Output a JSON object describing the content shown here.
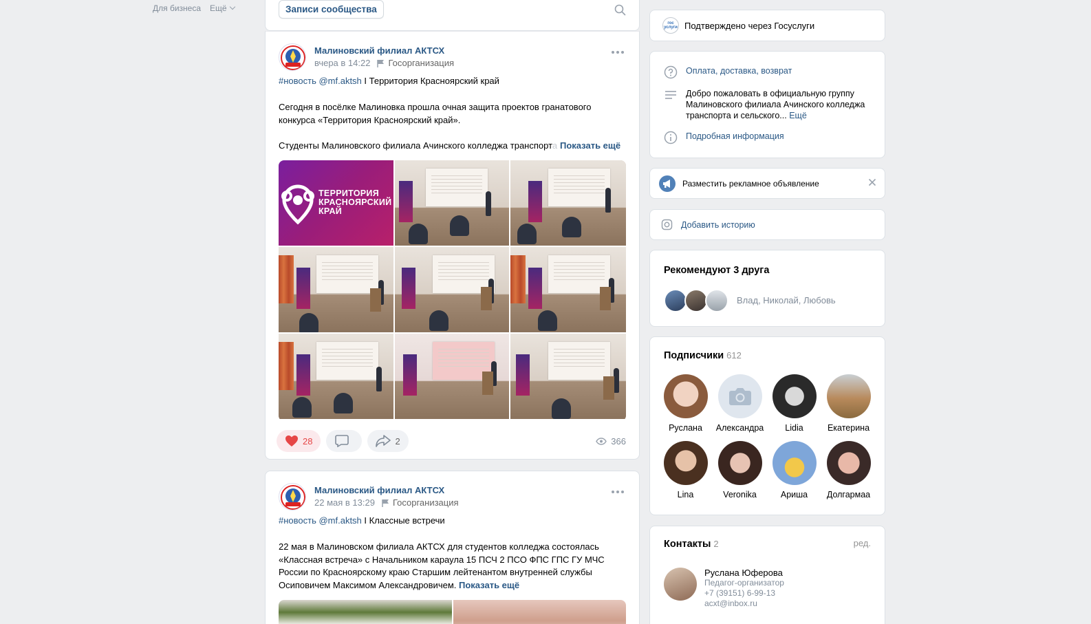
{
  "left_nav": {
    "business": "Для бизнеса",
    "more": "Ещё"
  },
  "tabs": {
    "active": "Записи сообщества",
    "search_icon": "search-icon"
  },
  "colors": {
    "link": "#2a5885",
    "like_red": "#e64646",
    "brand_purple": "#7a1f9e"
  },
  "post1": {
    "author": "Малиновский филиал АКТСХ",
    "time": "вчера в 14:22",
    "org": "Госорганизация",
    "tags": "#новость @mf.aktsh",
    "title": " I Территория Красноярский край",
    "p1": "Сегодня в посёлке Малиновка прошла очная защита проектов гранатового конкурса «Территория Красноярский край».",
    "p2": "Студенты Малиновского филиала Ачинского колледжа транспорт",
    "p2_fade": "а",
    "show_more": "Показать ещё",
    "brand_line1": "ТЕРРИТОРИЯ",
    "brand_line2": "КРАСНОЯРСКИЙ",
    "brand_line3": "КРАЙ",
    "likes": "28",
    "comments": "",
    "shares": "2",
    "views": "366"
  },
  "post2": {
    "author": "Малиновский филиал АКТСХ",
    "time": "22 мая в 13:29",
    "org": "Госорганизация",
    "tags": "#новость @mf.aktsh",
    "title": " I Классные встречи",
    "text": "22 мая в Малиновском филиала АКТСХ для студентов колледжа состоялась «Классная встреча» с Начальником караула 15 ПСЧ 2 ПСО ФПС ГПС ГУ МЧС России по Красноярскому краю Старшим лейтенантом внутренней службы Осиповичем Максимом Александровичем.",
    "show_more": "Показать ещё"
  },
  "right": {
    "gos_badge": "гос услуги",
    "gosuslugi": "Подтверждено через Госуслуги",
    "payment": "Оплата, доставка, возврат",
    "welcome": "Добро пожаловать в официальную группу Малиновского филиала Ачинского колледжа транспорта и сельского...",
    "welcome_more": "Ещё",
    "details": "Подробная информация",
    "ad": "Разместить рекламное объявление",
    "story": "Добавить историю",
    "friends_title": "Рекомендуют 3 друга",
    "friends_names": "Влад, Николай, Любовь",
    "subs_title": "Подписчики",
    "subs_count": "612",
    "subscribers": [
      "Руслана",
      "Александра",
      "Lidia",
      "Екатерина",
      "Lina",
      "Veronika",
      "Ариша",
      "Долгармаа"
    ],
    "contacts_title": "Контакты",
    "contacts_count": "2",
    "contacts_edit": "ред.",
    "contact_name": "Руслана Юферова",
    "contact_role": "Педагог-организатор",
    "contact_phone": "+7 (39151) 6-99-13",
    "contact_email": "acxt@inbox.ru"
  }
}
